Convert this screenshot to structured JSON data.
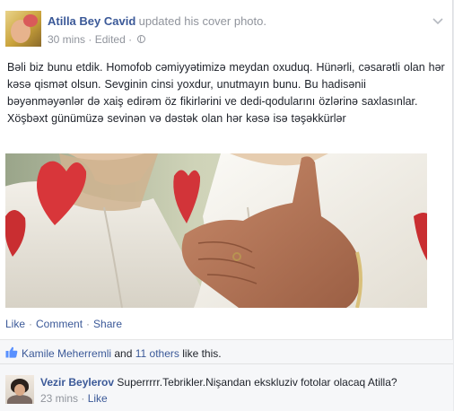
{
  "post": {
    "author": "Atilla Bey Cavid",
    "action": "updated his cover photo.",
    "time": "30 mins",
    "edited": "Edited",
    "privacy_icon": "globe-icon",
    "menu_icon": "chevron-down-icon",
    "body": "Bəli biz bunu etdik. Homofob cəmiyyətimizə meydan oxuduq. Hünərli, cəsarətli olan hər kəsə qismət olsun. Sevginin cinsi yoxdur, unutmayın bunu. Bu hadisənii bəyənməyənlər də xaiş edirəm öz fikirlərini ve dedi-qodularını özlərinə saxlasınlar. Xöşbəxt günümüzə sevinən və dəstək olan hər kəsə isə təşəkkürlər"
  },
  "actions": {
    "like": "Like",
    "comment": "Comment",
    "share": "Share",
    "separator": "·"
  },
  "likes": {
    "icon": "thumbs-up-icon",
    "name": "Kamile Meherremli",
    "and": "and",
    "others": "11 others",
    "suffix": "like this."
  },
  "comment": {
    "author": "Vezir Beylerov",
    "text": "Superrrrr.Tebrikler.Nişandan ekskluziv fotolar olacaq Atilla?",
    "time": "23 mins",
    "separator": "·",
    "like": "Like"
  },
  "colors": {
    "link": "#3b5998",
    "meta": "#90949c",
    "heart_red": "#d8363a"
  }
}
